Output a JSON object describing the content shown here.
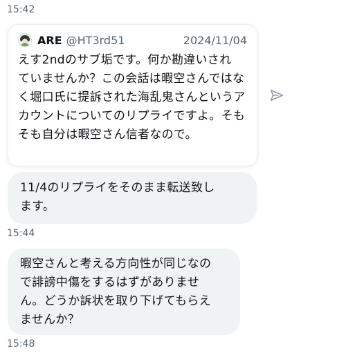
{
  "messages": {
    "time1": "15:42",
    "quote": {
      "name": "ARE",
      "handle": "@HT3rd51",
      "date": "2024/11/04",
      "lines": [
        "えす2ndのサブ垢です。何か勘違いされ",
        "ていませんか？この会話は暇空さんではな",
        "く堀口氏に提訴された海乱鬼さんというア",
        "カウントについてのリプライですよ。そも",
        "そも自分は暇空さん信者なので。"
      ]
    },
    "bubble1": {
      "lines": [
        "11/4のリプライをそのまま転送致し",
        "ます。"
      ]
    },
    "time2": "15:44",
    "bubble2": {
      "lines": [
        "暇空さんと考える方向性が同じなの",
        "で誹謗中傷をするはずがありませ",
        "ん。どうか訴状を取り下げてもらえ",
        "ませんか？"
      ]
    },
    "time3": "15:48"
  },
  "icons": {
    "share": "send-arrow-icon",
    "avatar": "avatar-icon"
  },
  "colors": {
    "bubble_bg": "#eff3f4",
    "text": "#0f1419",
    "muted": "#536471",
    "icon": "#8b98a5"
  }
}
